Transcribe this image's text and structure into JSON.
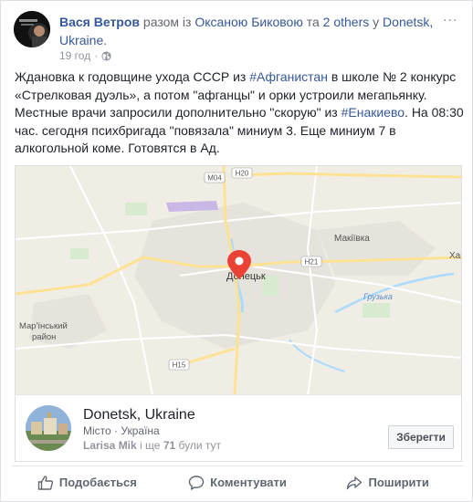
{
  "header": {
    "author": "Вася Ветров",
    "with_prefix": "разом із",
    "tagged_person": "Оксаною Биковою",
    "and_word": "та",
    "others": "2 others",
    "location_prefix": "у",
    "location": "Donetsk, Ukraine",
    "location_suffix": ".",
    "time": "19 год",
    "dot": "·",
    "privacy_icon": "globe-icon",
    "menu": "..."
  },
  "post": {
    "text_1": "Ждановка к годовщине ухода СССР из ",
    "hashtag_1": "#Афганистан",
    "text_2": " в школе № 2 конкурс «Стрелковая дуэль», а потом \"афганцы\" и орки устроили мегапьянку. Местные врачи запросили дополнительно \"скорую\" из ",
    "hashtag_2": "#Енакиево",
    "text_3": ". На 08:30 час. сегодня психбригада \"повязала\" миниум 3. Еще миниум 7 в алкогольной коме. Готовятся в Ад."
  },
  "map": {
    "city_label": "Донецьк",
    "makiivka": "Макіївка",
    "khar": "Хар",
    "marinsky": "Мар'їнський",
    "raion": "район",
    "gruzka": "Грузька",
    "road_m04": "M04",
    "road_h20": "H20",
    "road_h21": "H21",
    "road_h15": "H15",
    "colors": {
      "land": "#f0ede5",
      "urban": "#e4e1da",
      "road": "#ffffff",
      "major_road": "#fde293",
      "water": "#aadaff",
      "green": "#cfe9c3",
      "pin": "#ea4335"
    }
  },
  "place": {
    "title": "Donetsk, Ukraine",
    "category": "Місто",
    "dot": "·",
    "country": "Україна",
    "visitor_name": "Larisa Mik",
    "and_word": "і ще",
    "visitor_count": "71",
    "visited": "були тут",
    "save_label": "Зберегти"
  },
  "actions": {
    "like": "Подобається",
    "comment": "Коментувати",
    "share": "Поширити"
  }
}
